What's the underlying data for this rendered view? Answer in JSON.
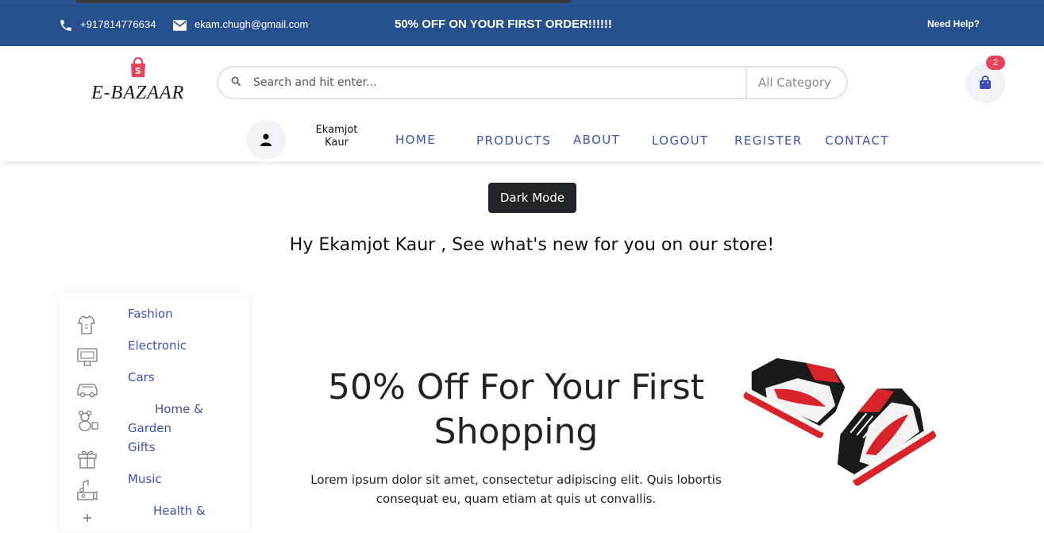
{
  "topbar": {
    "phone": "+917814776634",
    "email": "ekam.chugh@gmail.com",
    "promo": "50% OFF ON YOUR FIRST ORDER!!!!!!",
    "help": "Need Help?"
  },
  "header": {
    "logo": "E-BAZAAR",
    "search_placeholder": "Search and hit enter...",
    "category": "All Category",
    "cart_count": "2"
  },
  "user": {
    "name": "Ekamjot Kaur"
  },
  "nav": {
    "home": "HOME",
    "products": "PRODUCTS",
    "about": "ABOUT",
    "logout": "LOGOUT",
    "register": "REGISTER",
    "contact": "CONTACT"
  },
  "dark_mode_label": "Dark Mode",
  "greeting": "Hy Ekamjot Kaur , See what's new for you on our store!",
  "categories": [
    {
      "label": "Fashion",
      "icon": "fashion-icon"
    },
    {
      "label": "Electronic",
      "icon": "electronic-icon"
    },
    {
      "label": "Cars",
      "icon": "car-icon"
    },
    {
      "label": "Home &",
      "label2": "Garden",
      "icon": "teddy-icon"
    },
    {
      "label": "Gifts",
      "icon": "gift-icon"
    },
    {
      "label": "Music",
      "icon": "music-icon"
    },
    {
      "label": "Health &",
      "icon": "health-icon"
    }
  ],
  "hero": {
    "title": "50% Off For Your First Shopping",
    "text": "Lorem ipsum dolor sit amet, consectetur adipiscing elit. Quis lobortis consequat eu, quam etiam at quis ut convallis."
  },
  "colors": {
    "topbar": "#26508d",
    "nav_link": "#3f51b5",
    "badge": "#e8415a",
    "logo_bag": "#e8415a",
    "dark_button": "#212529"
  }
}
